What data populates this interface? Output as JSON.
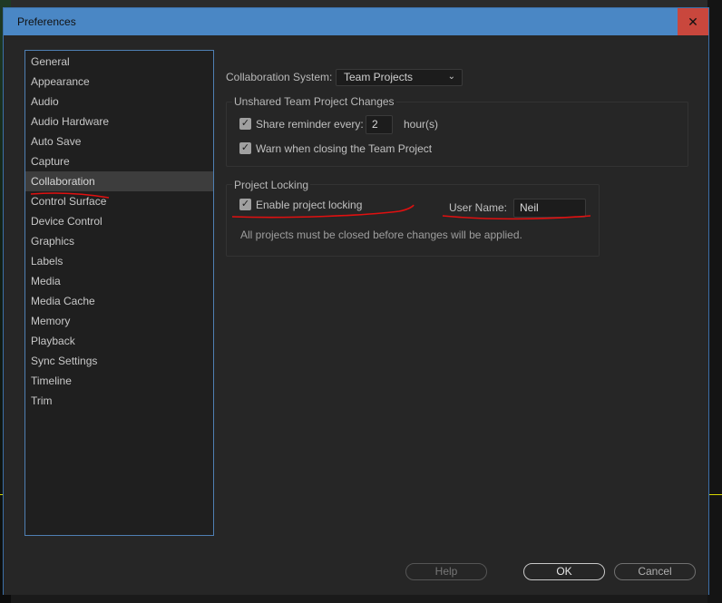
{
  "window": {
    "title": "Preferences",
    "close_glyph": "✕"
  },
  "sidebar": {
    "items": [
      {
        "label": "General"
      },
      {
        "label": "Appearance"
      },
      {
        "label": "Audio"
      },
      {
        "label": "Audio Hardware"
      },
      {
        "label": "Auto Save"
      },
      {
        "label": "Capture"
      },
      {
        "label": "Collaboration",
        "selected": true
      },
      {
        "label": "Control Surface"
      },
      {
        "label": "Device Control"
      },
      {
        "label": "Graphics"
      },
      {
        "label": "Labels"
      },
      {
        "label": "Media"
      },
      {
        "label": "Media Cache"
      },
      {
        "label": "Memory"
      },
      {
        "label": "Playback"
      },
      {
        "label": "Sync Settings"
      },
      {
        "label": "Timeline"
      },
      {
        "label": "Trim"
      }
    ]
  },
  "collaboration": {
    "system_label": "Collaboration System:",
    "system_value": "Team Projects",
    "unshared": {
      "title": "Unshared Team Project Changes",
      "share_label": "Share reminder every:",
      "share_checked": true,
      "share_value": "2",
      "share_unit": "hour(s)",
      "warn_label": "Warn when closing the Team Project",
      "warn_checked": true
    },
    "locking": {
      "title": "Project Locking",
      "enable_label": "Enable project locking",
      "enable_checked": true,
      "username_label": "User Name:",
      "username_value": "Neil",
      "note": "All projects must be closed before changes will be applied."
    }
  },
  "buttons": {
    "help": "Help",
    "ok": "OK",
    "cancel": "Cancel"
  },
  "colors": {
    "titlebar": "#4a87c5",
    "close": "#c9473d",
    "annotation": "#e01010",
    "selection": "#3d3d3d"
  }
}
